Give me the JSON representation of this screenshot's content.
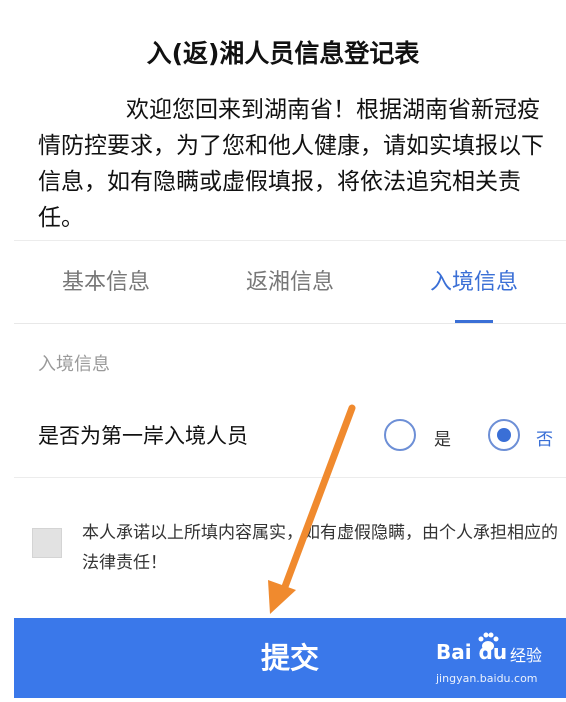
{
  "header": {
    "title": "入(返)湘人员信息登记表",
    "intro": "欢迎您回来到湖南省！根据湖南省新冠疫情防控要求，为了您和他人健康，请如实填报以下信息，如有隐瞒或虚假填报，将依法追究相关责任。"
  },
  "tabs": [
    {
      "label": "基本信息",
      "active": false
    },
    {
      "label": "返湘信息",
      "active": false
    },
    {
      "label": "入境信息",
      "active": true
    }
  ],
  "section": {
    "label": "入境信息"
  },
  "question": {
    "label": "是否为第一岸入境人员",
    "options": [
      {
        "label": "是",
        "selected": false
      },
      {
        "label": "否",
        "selected": true
      }
    ]
  },
  "agreement": {
    "checked": false,
    "text": "本人承诺以上所填内容属实，如有虚假隐瞒，由个人承担相应的法律责任！"
  },
  "submit": {
    "label": "提交"
  },
  "watermark": {
    "logo": "Bai du",
    "sub": "经验",
    "url": "jingyan.baidu.com"
  },
  "colors": {
    "accent": "#3a6fd6",
    "button": "#3a78ea",
    "arrow": "#f08a2e"
  }
}
